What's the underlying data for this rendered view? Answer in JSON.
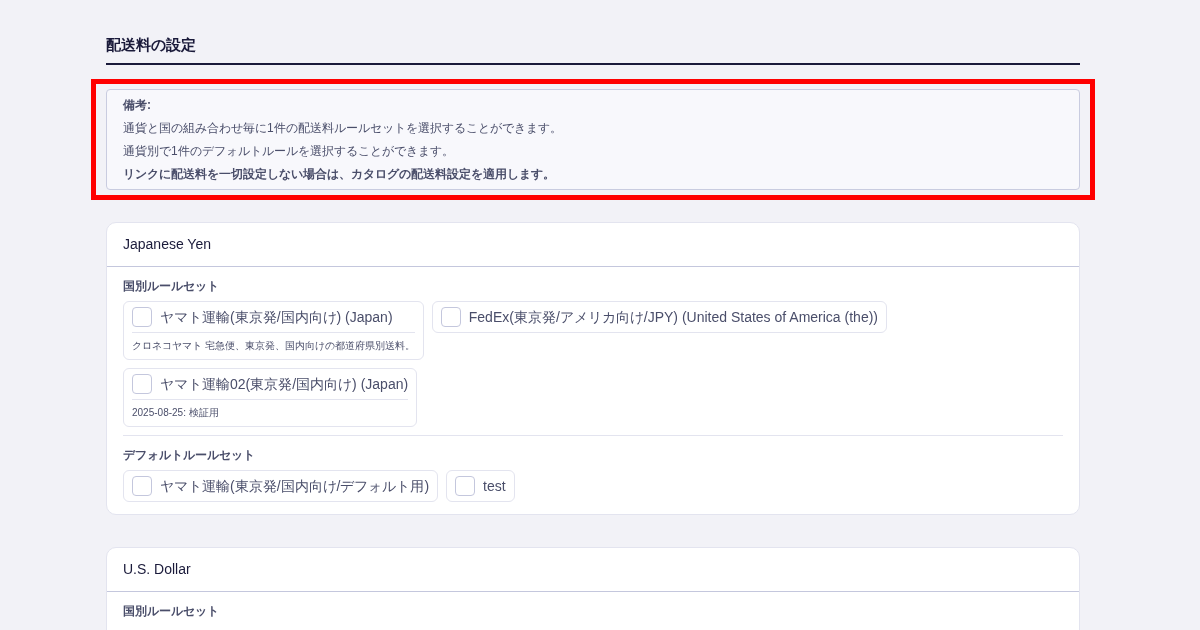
{
  "page_title": "配送料の設定",
  "notes": {
    "highlighted": true,
    "heading": "備考:",
    "lines": [
      {
        "text": "通貨と国の組み合わせ毎に1件の配送料ルールセットを選択することができます。",
        "bold": false
      },
      {
        "text": "通貨別で1件のデフォルトルールを選択することができます。",
        "bold": false
      },
      {
        "text": "リンクに配送料を一切設定しない場合は、カタログの配送料設定を適用します。",
        "bold": true
      }
    ]
  },
  "currencies": [
    {
      "name": "Japanese Yen",
      "sections": [
        {
          "label": "国別ルールセット",
          "options": [
            {
              "label": "ヤマト運輸(東京発/国内向け) (Japan)",
              "checked": false,
              "description": "クロネコヤマト 宅急便、東京発、国内向けの都道府県別送料。"
            },
            {
              "label": "FedEx(東京発/アメリカ向け/JPY) (United States of America (the))",
              "checked": false
            },
            {
              "label": "ヤマト運輸02(東京発/国内向け) (Japan)",
              "checked": false,
              "description": "2025-08-25: 検証用"
            }
          ]
        },
        {
          "label": "デフォルトルールセット",
          "options": [
            {
              "label": "ヤマト運輸(東京発/国内向け/デフォルト用)",
              "checked": false
            },
            {
              "label": "test",
              "checked": false
            }
          ]
        }
      ]
    },
    {
      "name": "U.S. Dollar",
      "sections": [
        {
          "label": "国別ルールセット"
        }
      ]
    }
  ]
}
